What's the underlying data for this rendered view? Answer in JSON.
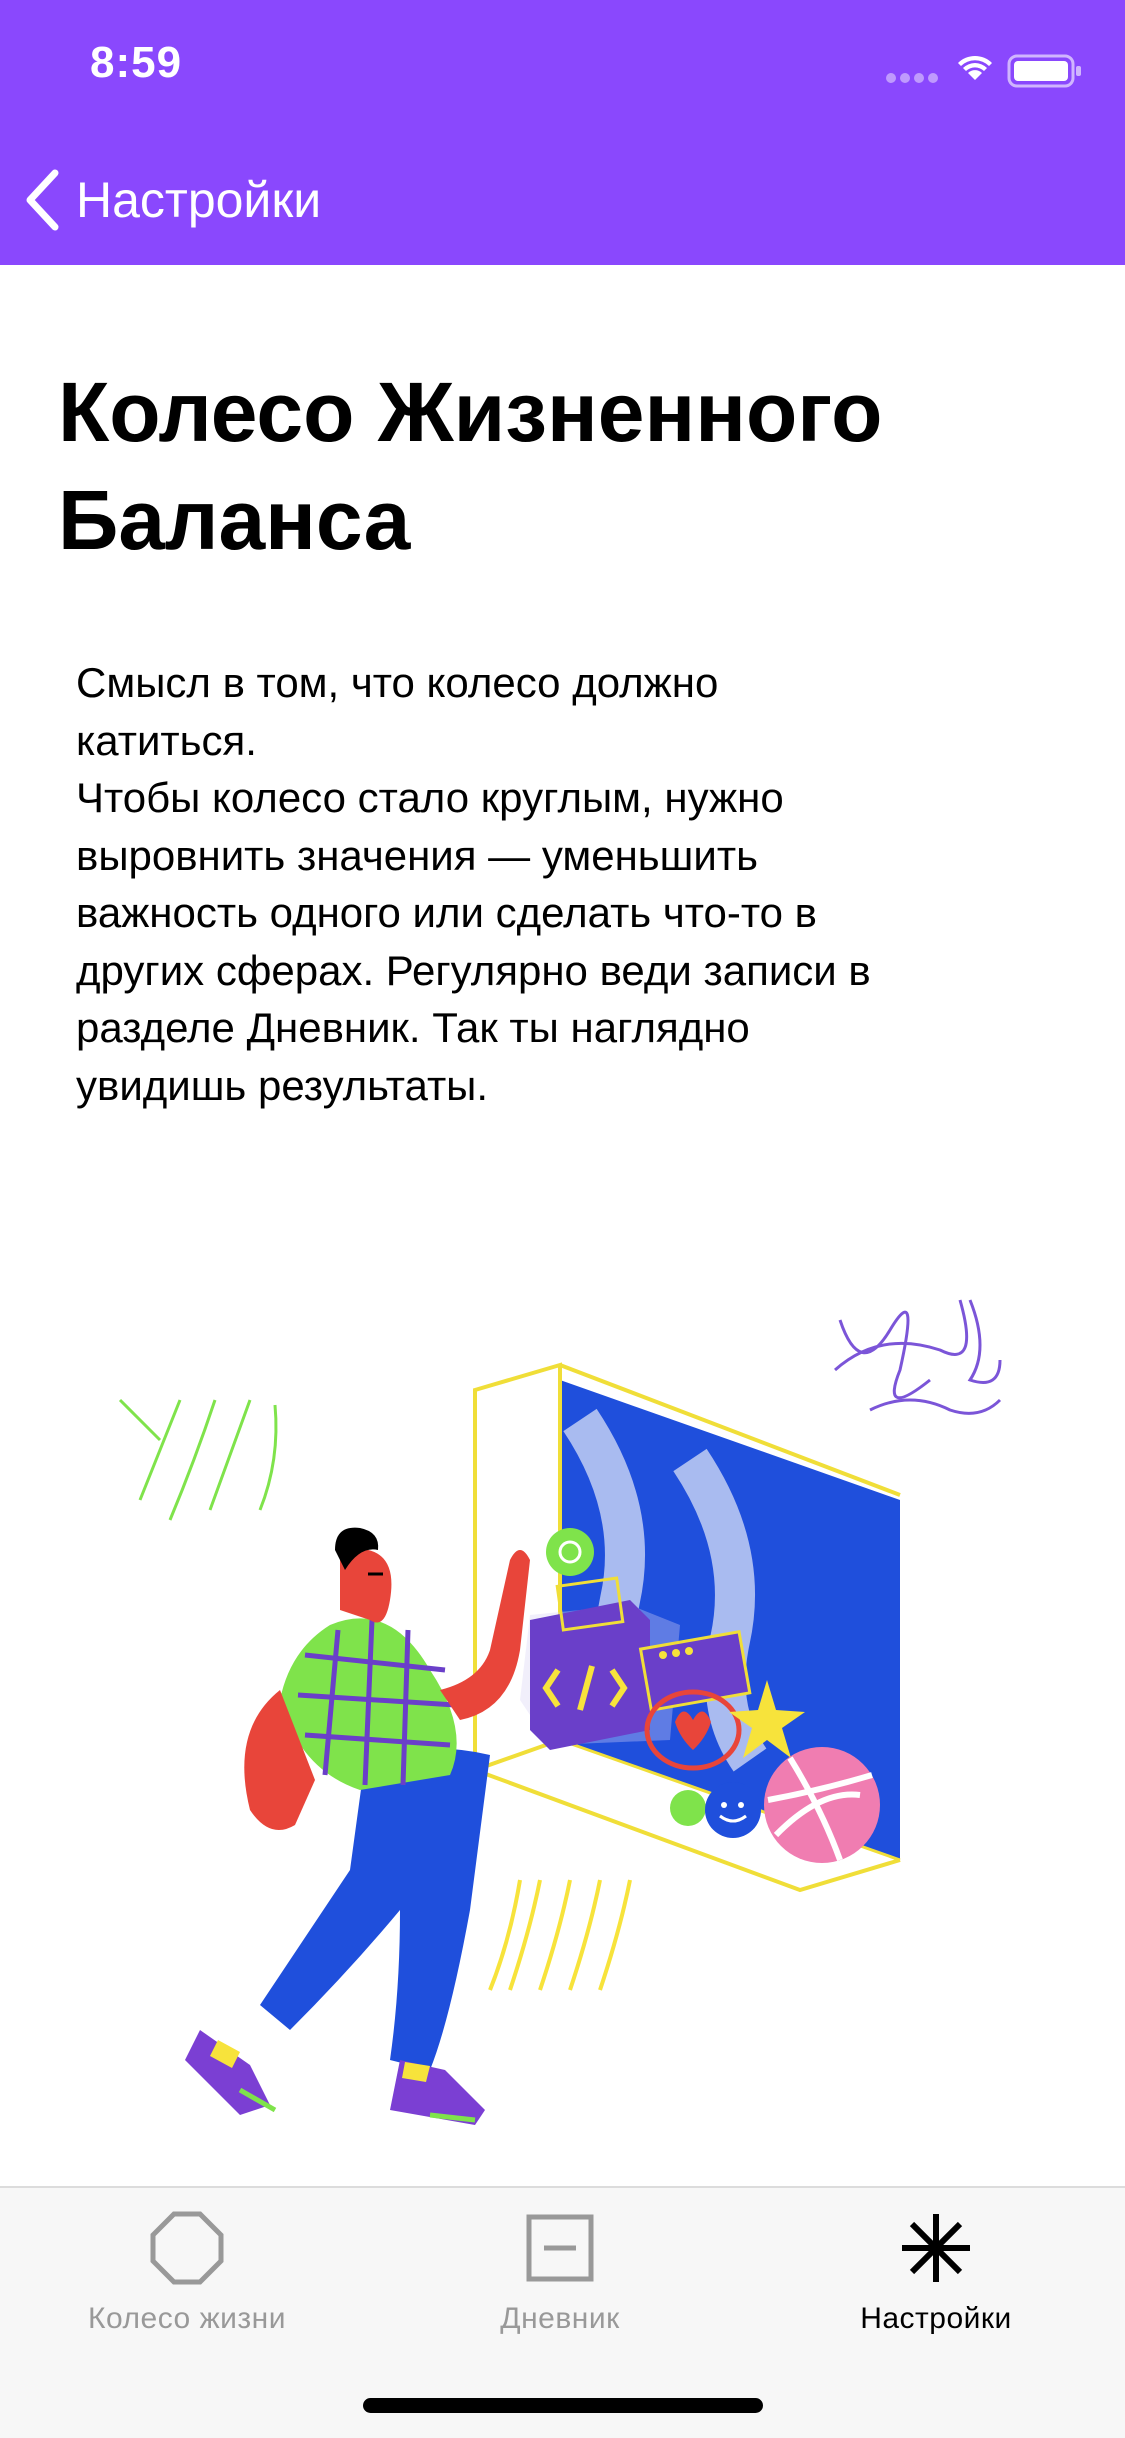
{
  "status_bar": {
    "time": "8:59"
  },
  "nav": {
    "back_label": "Настройки"
  },
  "page": {
    "title": "Колесо Жизненного Баланса",
    "description_lines": [
      "Смысл в том, что колесо должно",
      "катиться.",
      "Чтобы колесо стало круглым, нужно",
      "выровнить значения — уменьшить",
      "важность одного или сделать что-то в",
      "других сферах. Регулярно веди записи в",
      "разделе Дневник. Так ты наглядно",
      "увидишь результаты."
    ]
  },
  "tab_bar": {
    "tabs": [
      {
        "label": "Колесо жизни",
        "icon": "octagon-icon",
        "active": false
      },
      {
        "label": "Дневник",
        "icon": "minus-square-icon",
        "active": false
      },
      {
        "label": "Настройки",
        "icon": "asterisk-icon",
        "active": true
      }
    ]
  },
  "colors": {
    "accent": "#8a48fd",
    "tab_inactive": "#999999",
    "tab_active": "#000000"
  }
}
